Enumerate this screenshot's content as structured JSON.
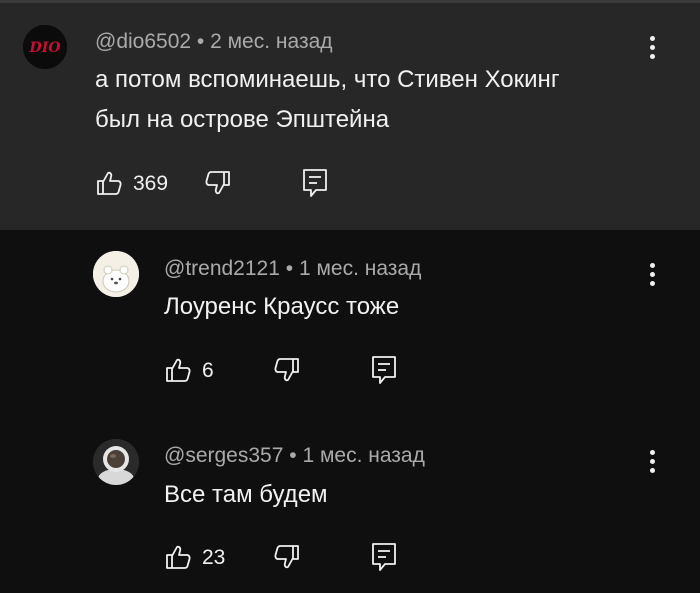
{
  "colors": {
    "parent_bg": "#272727",
    "page_bg": "#0f0f0f",
    "primary_text": "#f1f1f1",
    "secondary_text": "#aaaaaa",
    "avatar1_bg": "#0b0b0b",
    "avatar1_logo": "#c8102e"
  },
  "comment": {
    "author": "@dio6502",
    "time": "2 мес. назад",
    "text_line1": "а потом вспоминаешь, что Стивен Хокинг",
    "text_line2": "был на острове Эпштейна",
    "likes": "369",
    "avatar_logo_text": "DIO"
  },
  "replies": [
    {
      "author": "@trend2121",
      "time": "1 мес. назад",
      "text": "Лоуренс Краусс тоже",
      "likes": "6"
    },
    {
      "author": "@serges357",
      "time": "1 мес. назад",
      "text": "Все там будем",
      "likes": "23"
    }
  ],
  "icons": {
    "like": "thumbs-up-icon",
    "dislike": "thumbs-down-icon",
    "reply": "reply-icon",
    "more": "more-vertical-icon"
  },
  "separator": "•"
}
